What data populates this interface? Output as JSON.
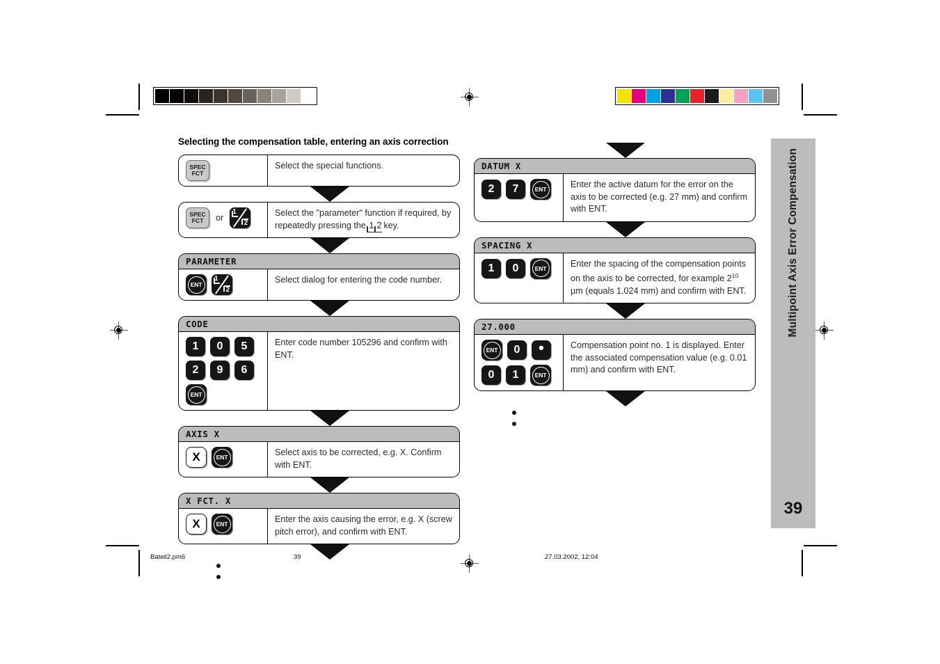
{
  "headline": "Selecting the compensation table, entering an axis correction",
  "sidebar": {
    "title": "Multipoint Axis Error Compensation",
    "page_number": "39",
    "bg_color": "#bcbcbc"
  },
  "footer": {
    "file": "Bateil2.pm6",
    "page": "39",
    "timestamp": "27.03.2002, 12:04"
  },
  "calibration": {
    "gray_swatches": [
      "#000000",
      "#050202",
      "#120d0a",
      "#2b2320",
      "#3c342f",
      "#524842",
      "#6b615b",
      "#8b827c",
      "#a9a29c",
      "#cfcac6",
      "#ffffff"
    ],
    "color_swatches": [
      "#f5e400",
      "#e6007e",
      "#00a0e3",
      "#2e3192",
      "#00a05a",
      "#e62129",
      "#1c1c1c",
      "#faeea0",
      "#f4a0c0",
      "#5bc5f2",
      "#919191"
    ]
  },
  "keys": {
    "spec_line1": "SPEC",
    "spec_line2": "FCT",
    "ent": "ENT",
    "x": "X",
    "or": "or",
    "dot": "•",
    "half_n1": "1",
    "half_n2": "2"
  },
  "left_column": [
    {
      "id": "spec-functions",
      "title": null,
      "keys": [
        {
          "type": "spec"
        }
      ],
      "desc_html": "Select the special functions."
    },
    {
      "id": "parameter-function",
      "title": null,
      "keys": [
        {
          "type": "spec"
        },
        {
          "type": "or"
        },
        {
          "type": "half"
        }
      ],
      "desc_html": "Select the \"parameter\" function if required, by repeatedly pressing the [1 [2 key."
    },
    {
      "id": "parameter",
      "title": "PARAMETER",
      "keys": [
        {
          "type": "ent"
        },
        {
          "type": "half"
        }
      ],
      "desc_html": "Select dialog for entering the code number."
    },
    {
      "id": "code",
      "title": "CODE",
      "keys": [
        {
          "type": "digit",
          "label": "1"
        },
        {
          "type": "digit",
          "label": "0"
        },
        {
          "type": "digit",
          "label": "5"
        },
        {
          "type": "digit",
          "label": "2"
        },
        {
          "type": "digit",
          "label": "9"
        },
        {
          "type": "digit",
          "label": "6"
        },
        {
          "type": "ent"
        }
      ],
      "desc_html": "Enter code number 105296 and confirm with ENT."
    },
    {
      "id": "axis-x",
      "title": "AXIS X",
      "keys": [
        {
          "type": "x"
        },
        {
          "type": "ent"
        }
      ],
      "desc_html": "Select axis to be corrected, e.g.  X. Confirm with ENT."
    },
    {
      "id": "x-fct-x",
      "title": "X  FCT. X",
      "keys": [
        {
          "type": "x"
        },
        {
          "type": "ent"
        }
      ],
      "desc_html": "Enter the axis causing the error, e.g. X (screw pitch error), and confirm with ENT."
    }
  ],
  "right_column": [
    {
      "id": "datum-x",
      "title": "DATUM X",
      "keys": [
        {
          "type": "digit",
          "label": "2"
        },
        {
          "type": "digit",
          "label": "7"
        },
        {
          "type": "ent"
        }
      ],
      "desc_html": "Enter the active datum for the error on the axis to be corrected (e.g. 27 mm) and confirm with ENT."
    },
    {
      "id": "spacing-x",
      "title": "SPACING X",
      "keys": [
        {
          "type": "digit",
          "label": "1"
        },
        {
          "type": "digit",
          "label": "0"
        },
        {
          "type": "ent"
        }
      ],
      "desc_parts": {
        "before": "Enter the spacing of the compensation points on the axis to be corrected, for example 2",
        "sup": "10",
        "after": " µm (equals 1.024 mm) and confirm with ENT."
      }
    },
    {
      "id": "compensation-point",
      "title": "27.000",
      "keys": [
        {
          "type": "ent"
        },
        {
          "type": "digit",
          "label": "0"
        },
        {
          "type": "dot"
        },
        {
          "type": "digit",
          "label": "0"
        },
        {
          "type": "digit",
          "label": "1"
        },
        {
          "type": "ent"
        }
      ],
      "desc_html": "Compensation point no. 1 is displayed. Enter the associated compensation value (e.g. 0.01 mm) and confirm with ENT."
    }
  ]
}
